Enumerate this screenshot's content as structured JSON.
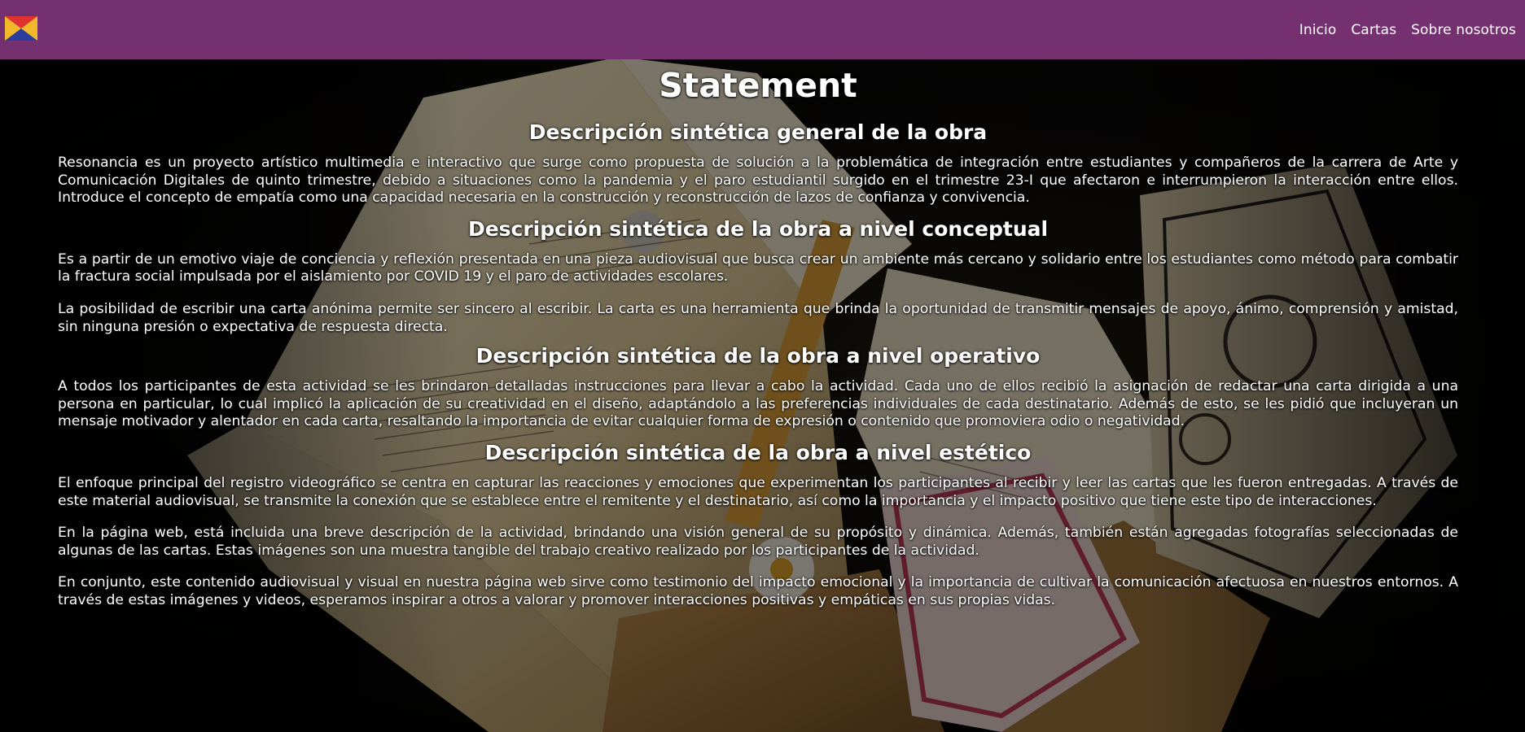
{
  "navbar": {
    "logo_icon": "flag-triangles-logo-icon",
    "links": [
      "Inicio",
      "Cartas",
      "Sobre nosotros"
    ],
    "background_color": "#74306f"
  },
  "main": {
    "title": "Statement",
    "sections": [
      {
        "heading": "Descripción sintética general de la obra",
        "paragraphs": [
          "Resonancia es un proyecto artístico multimedia e interactivo que surge como propuesta de solución a la problemática de integración entre estudiantes y compañeros de la carrera de Arte y Comunicación Digitales de quinto trimestre, debido a situaciones como la pandemia y el paro estudiantil surgido en el trimestre 23-I que afectaron e interrumpieron la interacción entre ellos. Introduce el concepto de empatía como una capacidad necesaria en la construcción y reconstrucción de lazos de confianza y convivencia."
        ]
      },
      {
        "heading": "Descripción sintética de la obra a nivel conceptual",
        "paragraphs": [
          "Es a partir de un emotivo viaje de conciencia y reflexión presentada en una pieza audiovisual que busca crear un ambiente más cercano y solidario entre los estudiantes como método para combatir la fractura social impulsada por el aislamiento por COVID 19 y el paro de actividades escolares.",
          "La posibilidad de escribir una carta anónima permite ser sincero al escribir. La carta es una herramienta que brinda la oportunidad de transmitir mensajes de apoyo, ánimo, comprensión y amistad, sin ninguna presión o expectativa de respuesta directa."
        ]
      },
      {
        "heading": "Descripción sintética de la obra a nivel operativo",
        "paragraphs": [
          "A todos los participantes de esta actividad se les brindaron detalladas instrucciones para llevar a cabo la actividad. Cada uno de ellos recibió la asignación de redactar una carta dirigida a una persona en particular, lo cual implicó la aplicación de su creatividad en el diseño, adaptándolo a las preferencias individuales de cada destinatario. Además de esto, se les pidió que incluyeran un mensaje motivador y alentador en cada carta, resaltando la importancia de evitar cualquier forma de expresión o contenido que promoviera odio o negatividad."
        ]
      },
      {
        "heading": "Descripción sintética de la obra a nivel estético",
        "paragraphs": [
          "El enfoque principal del registro videográfico se centra en capturar las reacciones y emociones que experimentan los participantes al recibir y leer las cartas que les fueron entregadas. A través de este material audiovisual, se transmite la conexión que se establece entre el remitente y el destinatario, así como la importancia y el impacto positivo que tiene este tipo de interacciones.",
          "En la página web, está incluida una breve descripción de la actividad, brindando una visión general de su propósito y dinámica. Además, también están agregadas fotografías seleccionadas de algunas de las cartas. Estas imágenes son una muestra tangible del trabajo creativo realizado por los participantes de la actividad.",
          "En conjunto, este contenido audiovisual y visual en nuestra página web sirve como testimonio del impacto emocional y la importancia de cultivar la comunicación afectuosa en nuestros entornos. A través de estas imágenes y videos, esperamos inspirar a otros a valorar y promover interacciones positivas y empáticas en sus propias vidas."
        ]
      }
    ]
  }
}
